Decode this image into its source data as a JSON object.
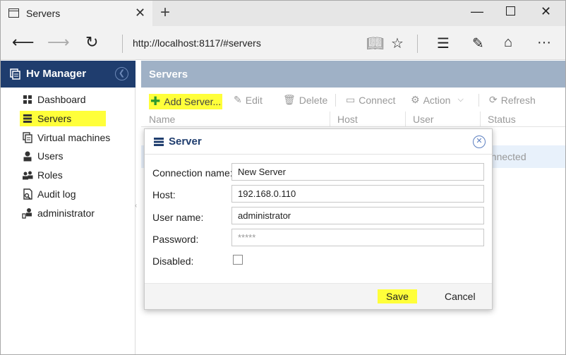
{
  "browser": {
    "tab_title": "Servers",
    "url": "http://localhost:8117/#servers"
  },
  "app": {
    "name": "Hv Manager",
    "sidebar": {
      "items": [
        {
          "label": "Dashboard",
          "icon": "dashboard-icon"
        },
        {
          "label": "Servers",
          "icon": "server-icon"
        },
        {
          "label": "Virtual machines",
          "icon": "vm-icon"
        },
        {
          "label": "Users",
          "icon": "user-icon"
        },
        {
          "label": "Roles",
          "icon": "roles-icon"
        },
        {
          "label": "Audit log",
          "icon": "audit-icon"
        },
        {
          "label": "administrator",
          "icon": "account-icon"
        }
      ]
    }
  },
  "main": {
    "title": "Servers",
    "toolbar": {
      "add": "Add Server...",
      "edit": "Edit",
      "delete": "Delete",
      "connect": "Connect",
      "action": "Action",
      "refresh": "Refresh"
    },
    "columns": [
      "Name",
      "Host",
      "User",
      "Status"
    ],
    "row_status": "onnected"
  },
  "dialog": {
    "title": "Server",
    "fields": {
      "connection_name_label": "Connection name:",
      "connection_name_value": "New Server",
      "host_label": "Host:",
      "host_value": "192.168.0.110",
      "username_label": "User name:",
      "username_value": "administrator",
      "password_label": "Password:",
      "password_placeholder": "*****",
      "disabled_label": "Disabled:"
    },
    "save": "Save",
    "cancel": "Cancel"
  },
  "colors": {
    "header": "#1f3d6e",
    "main_header": "#9fb1c6",
    "highlight": "#ffff3a",
    "selected_row": "#e8f1fb"
  }
}
